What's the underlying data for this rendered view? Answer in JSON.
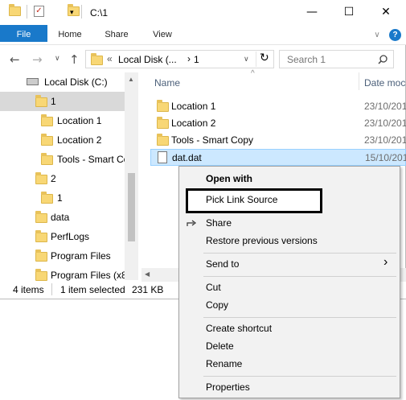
{
  "window": {
    "title": "C:\\1",
    "controls": {
      "minimize": "—",
      "maximize": "☐",
      "close": "✕"
    }
  },
  "ribbon": {
    "tabs": [
      "File",
      "Home",
      "Share",
      "View"
    ],
    "expand": "∨",
    "help": "?"
  },
  "address": {
    "back": "←",
    "forward": "→",
    "recent": "∨",
    "up": "↑",
    "overflow": "«",
    "crumbs": [
      "Local Disk (...",
      "1"
    ],
    "separator": "›",
    "dropdown": "∨",
    "refresh": "↻",
    "search_placeholder": "Search 1",
    "search_icon": "magnifier-icon"
  },
  "tree": {
    "items": [
      {
        "label": "Local Disk (C:)",
        "icon": "drive-icon"
      },
      {
        "label": "1",
        "icon": "folder-icon",
        "selected": true
      },
      {
        "label": "Location 1",
        "icon": "folder-icon"
      },
      {
        "label": "Location 2",
        "icon": "folder-icon"
      },
      {
        "label": "Tools - Smart Co",
        "icon": "folder-icon"
      },
      {
        "label": "2",
        "icon": "folder-icon"
      },
      {
        "label": "1",
        "icon": "folder-shortcut-icon"
      },
      {
        "label": "data",
        "icon": "folder-icon"
      },
      {
        "label": "PerfLogs",
        "icon": "folder-icon"
      },
      {
        "label": "Program Files",
        "icon": "folder-icon"
      },
      {
        "label": "Program Files (x8",
        "icon": "folder-icon"
      }
    ]
  },
  "list": {
    "columns": {
      "name": "Name",
      "date": "Date moc"
    },
    "sort_indicator": "^",
    "files": [
      {
        "name": "Location 1",
        "date": "23/10/201",
        "icon": "folder-icon"
      },
      {
        "name": "Location 2",
        "date": "23/10/201",
        "icon": "folder-icon"
      },
      {
        "name": "Tools - Smart Copy",
        "date": "23/10/201",
        "icon": "folder-icon"
      },
      {
        "name": "dat.dat",
        "date": "15/10/201",
        "icon": "file-icon",
        "selected": true
      }
    ]
  },
  "status": {
    "count": "4 items",
    "selection": "1 item selected",
    "size": "231 KB"
  },
  "context_menu": {
    "open_with": "Open with",
    "pick_link_source": "Pick Link Source",
    "share": "Share",
    "restore": "Restore previous versions",
    "send_to": "Send to",
    "send_to_arrow": "›",
    "cut": "Cut",
    "copy": "Copy",
    "create_shortcut": "Create shortcut",
    "delete": "Delete",
    "rename": "Rename",
    "properties": "Properties"
  },
  "colors": {
    "accent": "#1979ca",
    "selection": "#cce8ff",
    "tree_selection": "#d9d9d9",
    "folder": "#f8d775"
  }
}
